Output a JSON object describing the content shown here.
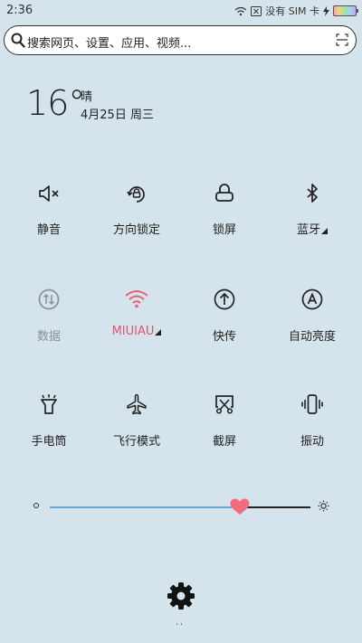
{
  "status": {
    "time": "2:36",
    "no_sim": "没有 SIM 卡"
  },
  "search": {
    "placeholder": "搜索网页、设置、应用、视频..."
  },
  "weather": {
    "temperature": "16°",
    "condition": "晴",
    "date": "4月25日 周三"
  },
  "toggles": [
    {
      "label": "静音",
      "icon": "mute-icon",
      "state": "on"
    },
    {
      "label": "方向锁定",
      "icon": "rotation-lock-icon",
      "state": "on"
    },
    {
      "label": "锁屏",
      "icon": "lock-icon",
      "state": "on"
    },
    {
      "label": "蓝牙",
      "icon": "bluetooth-icon",
      "state": "on"
    },
    {
      "label": "数据",
      "icon": "mobile-data-icon",
      "state": "disabled"
    },
    {
      "label": "MIUIAU",
      "icon": "wifi-icon",
      "state": "active"
    },
    {
      "label": "快传",
      "icon": "quick-transfer-icon",
      "state": "on"
    },
    {
      "label": "自动亮度",
      "icon": "auto-brightness-icon",
      "state": "on"
    },
    {
      "label": "手电筒",
      "icon": "flashlight-icon",
      "state": "on"
    },
    {
      "label": "飞行模式",
      "icon": "airplane-icon",
      "state": "on"
    },
    {
      "label": "截屏",
      "icon": "screenshot-icon",
      "state": "on"
    },
    {
      "label": "振动",
      "icon": "vibrate-icon",
      "state": "on"
    }
  ],
  "brightness": {
    "level": 0.73
  },
  "colors": {
    "background": "#d5e3ec",
    "accent": "#f26c7f",
    "slider_fill": "#6aa8d6",
    "wifi_active": "#e8606f"
  },
  "handle_glyph": "˙˙"
}
